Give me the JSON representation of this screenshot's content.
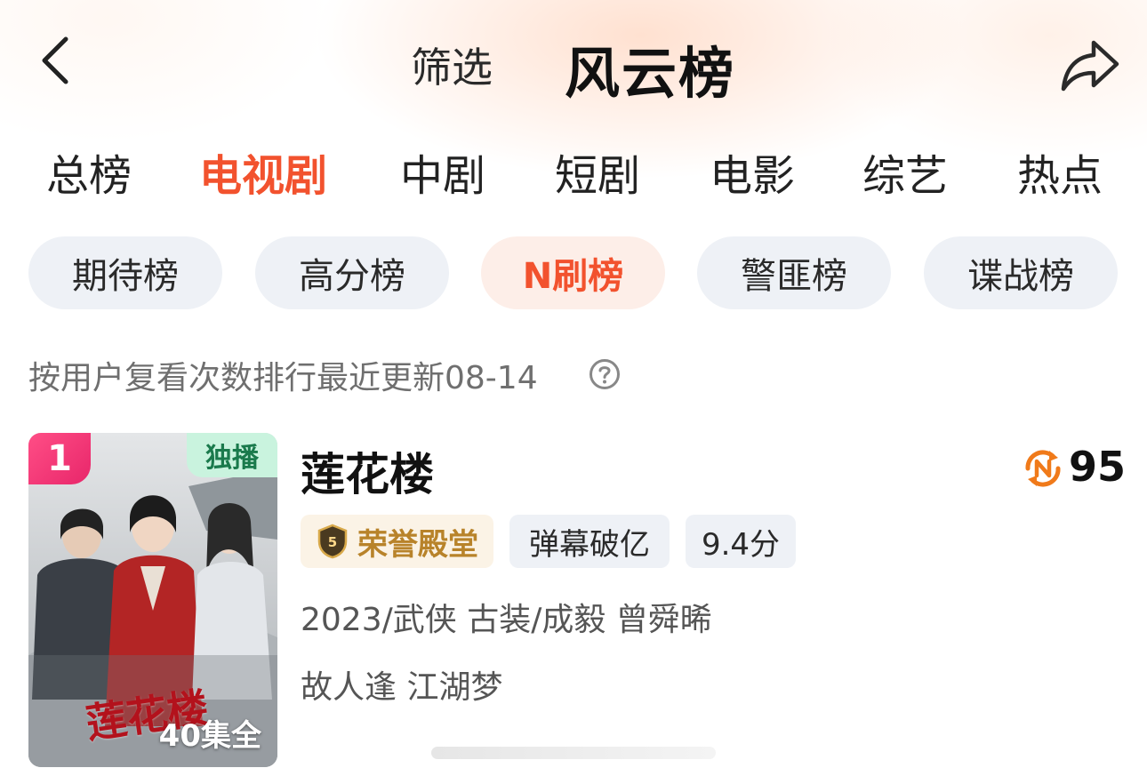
{
  "header": {
    "filter_label": "筛选",
    "title": "风云榜",
    "back_icon": "chevron-left-icon",
    "share_icon": "share-arrow-icon"
  },
  "tabs": [
    {
      "label": "总榜",
      "active": false
    },
    {
      "label": "电视剧",
      "active": true
    },
    {
      "label": "中剧",
      "active": false
    },
    {
      "label": "短剧",
      "active": false
    },
    {
      "label": "电影",
      "active": false
    },
    {
      "label": "综艺",
      "active": false
    },
    {
      "label": "热点",
      "active": false
    }
  ],
  "chips": [
    {
      "label": "期待榜",
      "active": false
    },
    {
      "label": "高分榜",
      "active": false
    },
    {
      "label": "N刷榜",
      "active": true
    },
    {
      "label": "警匪榜",
      "active": false
    },
    {
      "label": "谍战榜",
      "active": false
    }
  ],
  "description": "按用户复看次数排行最近更新08-14",
  "colors": {
    "accent": "#f2522e",
    "chip_bg": "#eef1f6",
    "chip_active_bg": "#fdeee8",
    "rank_badge": "#e8266a",
    "exclusive_badge_bg": "#c9f3de",
    "honor_gold": "#b8832a"
  },
  "items": [
    {
      "rank": "1",
      "exclusive_label": "独播",
      "poster_caption": "莲花楼",
      "episodes": "40集全",
      "title": "莲花楼",
      "n_score": "95",
      "honor_badge_level": "5",
      "honor_label": "荣誉殿堂",
      "tags": [
        "弹幕破亿",
        "9.4分"
      ],
      "meta_line1": "2023/武侠 古装/成毅 曾舜晞",
      "meta_line2": "故人逢 江湖梦"
    }
  ]
}
